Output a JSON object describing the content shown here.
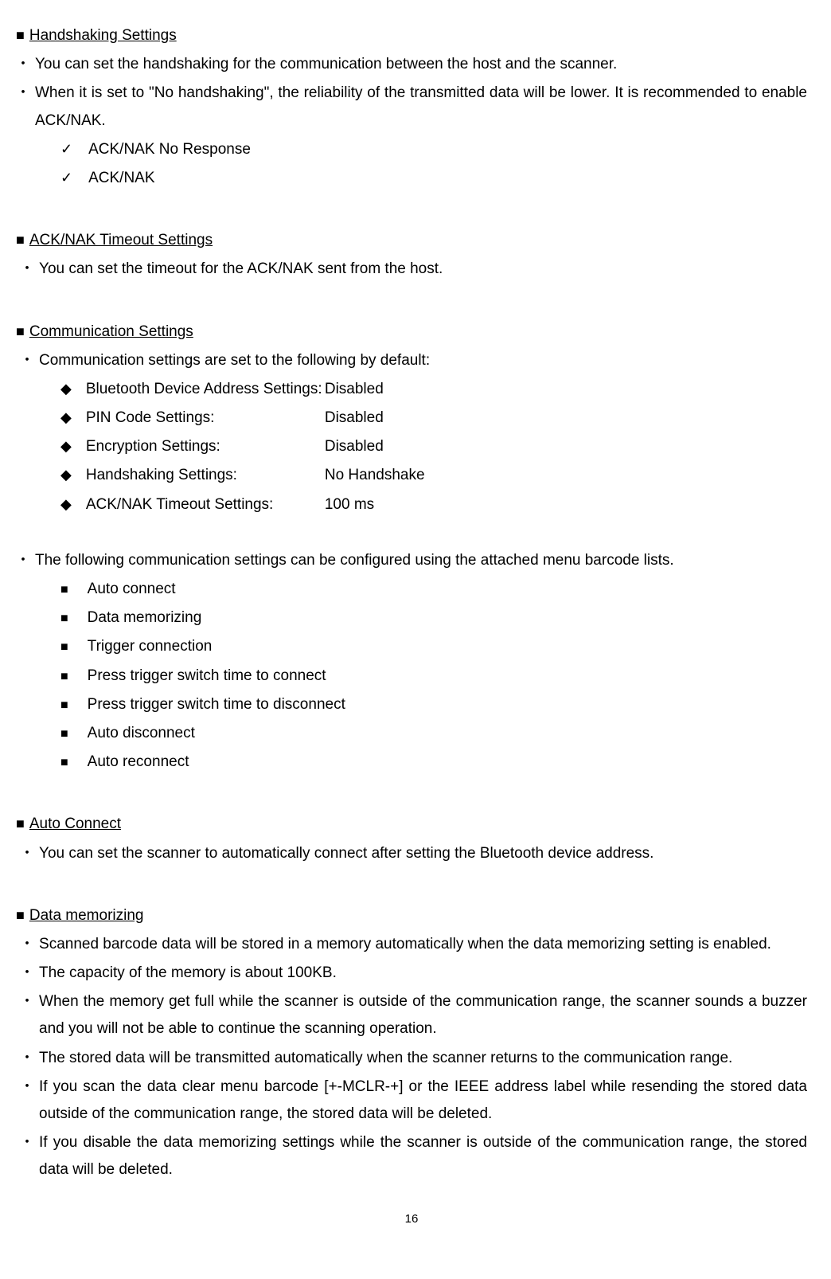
{
  "sections": {
    "handshaking": {
      "title": "Handshaking Settings",
      "points": [
        "You can set the handshaking for the communication between the host and the scanner.",
        "When it is set to \"No handshaking\", the reliability of the transmitted data will be lower. It is recommended to enable ACK/NAK."
      ],
      "checks": [
        "ACK/NAK No Response",
        "ACK/NAK"
      ]
    },
    "acknak_timeout": {
      "title": "ACK/NAK Timeout Settings",
      "points": [
        "You can set the timeout for the ACK/NAK sent from the host."
      ]
    },
    "comm": {
      "title": "Communication Settings",
      "intro": "Communication settings are set to the following by default:",
      "defaults": [
        {
          "label": "Bluetooth Device Address Settings:",
          "value": "Disabled"
        },
        {
          "label": "PIN Code Settings:",
          "value": "Disabled"
        },
        {
          "label": "Encryption Settings:",
          "value": "Disabled"
        },
        {
          "label": "Handshaking Settings:",
          "value": "No Handshake"
        },
        {
          "label": "ACK/NAK Timeout Settings:",
          "value": "100 ms"
        }
      ],
      "menu_intro": "The following communication settings can be configured using the attached menu barcode lists.",
      "menu_items": [
        "Auto connect",
        "Data memorizing",
        "Trigger connection",
        "Press trigger switch time to connect",
        "Press trigger switch time to disconnect",
        "Auto disconnect",
        "Auto reconnect"
      ]
    },
    "auto_connect": {
      "title": "Auto Connect",
      "points": [
        "You can set the scanner to automatically connect after setting the Bluetooth device address."
      ]
    },
    "data_mem": {
      "title": "Data memorizing",
      "points": [
        "Scanned barcode data will be stored in a memory automatically when the data memorizing setting is enabled.",
        "The capacity of the memory is about 100KB.",
        "When the memory get full while the scanner is outside of the communication range, the scanner sounds a buzzer and you will not be able to continue the scanning operation.",
        "The stored data will be transmitted automatically when the scanner returns to the communication range.",
        "If you scan the data clear menu barcode [+-MCLR-+] or the IEEE address label while resending the stored data outside of the communication range, the stored data will be deleted.",
        "If you disable the data memorizing settings while the scanner is outside of the communication range, the stored data will be deleted."
      ]
    }
  },
  "page_number": "16"
}
